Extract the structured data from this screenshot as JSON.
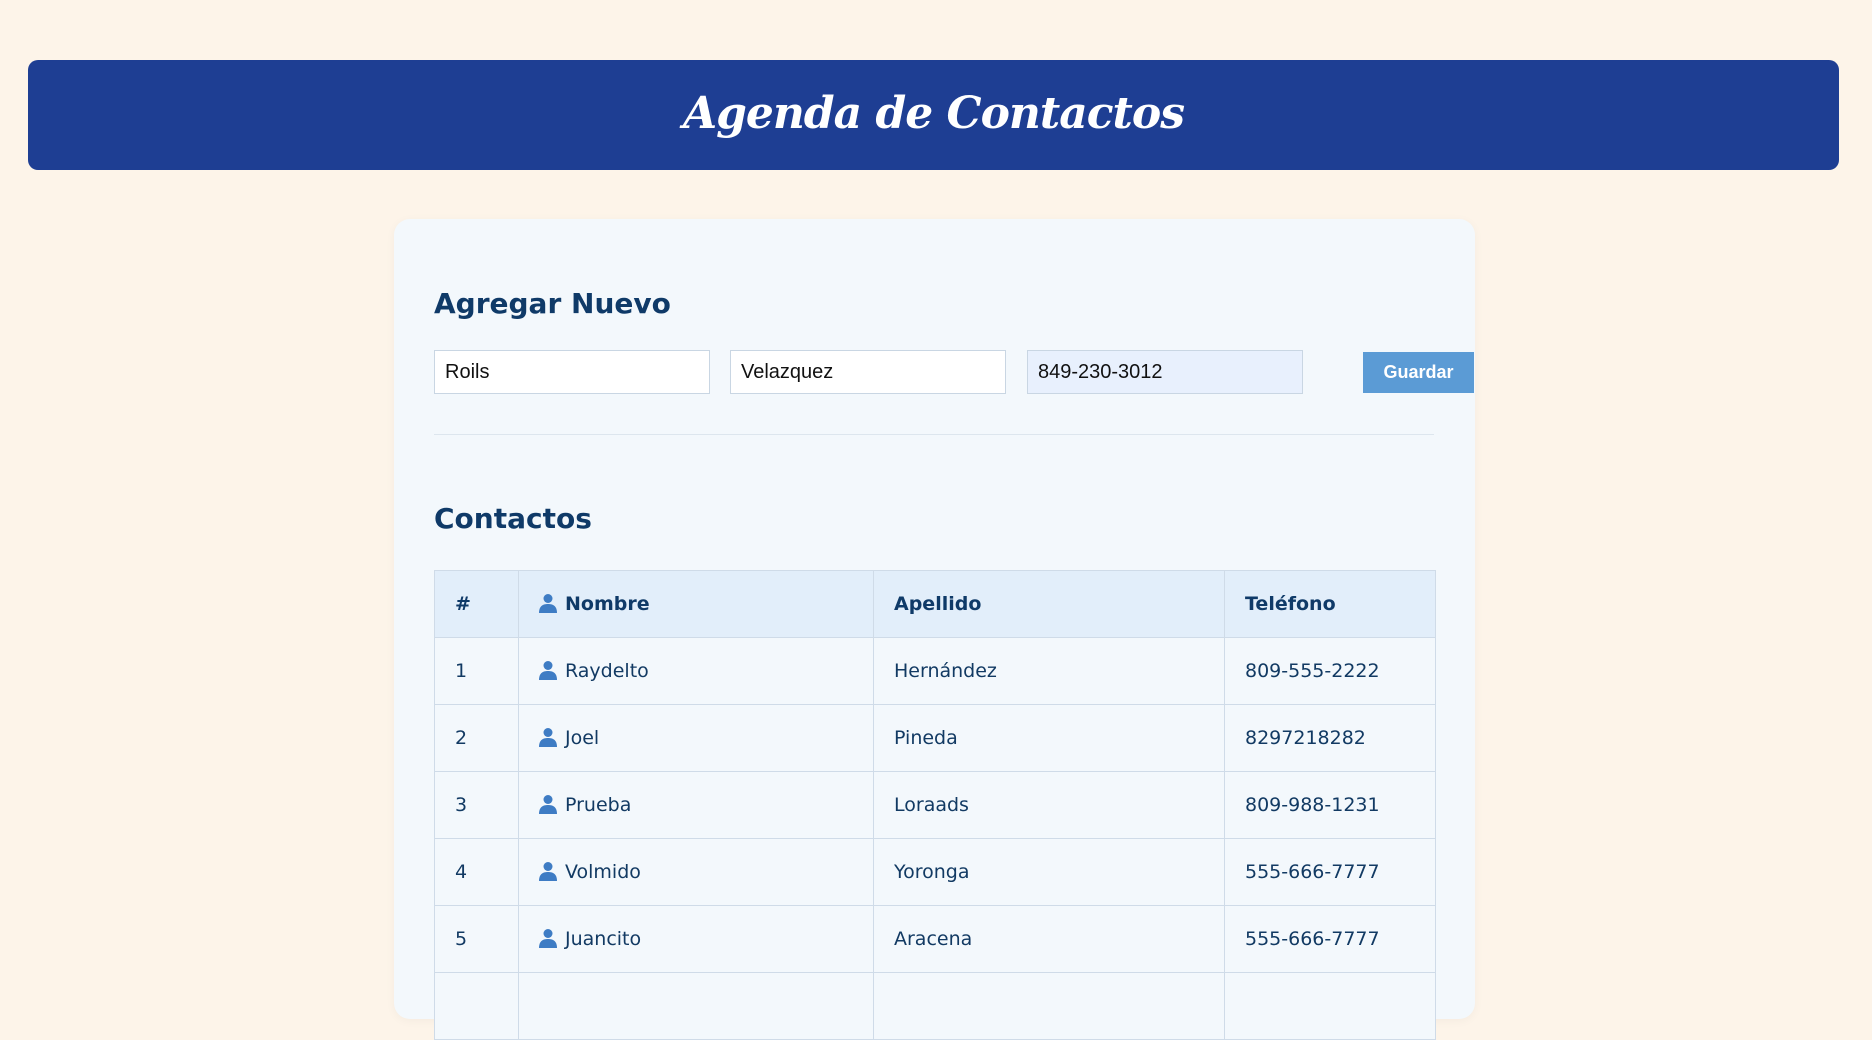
{
  "header": {
    "title": "Agenda de Contactos"
  },
  "add_form": {
    "title": "Agregar Nuevo",
    "first_name_value": "Roils",
    "last_name_value": "Velazquez",
    "phone_value": "849-230-3012",
    "save_label": "Guardar"
  },
  "contacts": {
    "title": "Contactos",
    "columns": {
      "num": "#",
      "name": "Nombre",
      "last": "Apellido",
      "phone": "Teléfono"
    },
    "rows": [
      {
        "num": "1",
        "name": "Raydelto",
        "last": "Hernández",
        "phone": "809-555-2222"
      },
      {
        "num": "2",
        "name": "Joel",
        "last": "Pineda",
        "phone": "8297218282"
      },
      {
        "num": "3",
        "name": "Prueba",
        "last": "Loraads",
        "phone": "809-988-1231"
      },
      {
        "num": "4",
        "name": "Volmido",
        "last": "Yoronga",
        "phone": "555-666-7777"
      },
      {
        "num": "5",
        "name": "Juancito",
        "last": "Aracena",
        "phone": "555-666-7777"
      }
    ]
  },
  "icons": {
    "person": "person-icon"
  },
  "colors": {
    "background": "#fdf4e9",
    "header": "#1e3e93",
    "accent": "#5b9bd5",
    "text": "#0f3a68"
  }
}
